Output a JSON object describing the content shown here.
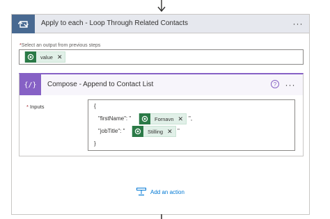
{
  "loop": {
    "title": "Apply to each - Loop Through Related Contacts",
    "more_label": "···",
    "select_label_required": "*",
    "select_label": "Select an output from previous steps",
    "token": {
      "label": "value",
      "icon": "dataverse-icon",
      "close": "✕"
    }
  },
  "compose": {
    "title": "Compose - Append to Contact List",
    "help_label": "?",
    "more_label": "···",
    "inputs_label_required": "*",
    "inputs_label": "Inputs",
    "json": {
      "open": "{",
      "line1_prefix": "\"firstName\": \"",
      "line1_token": "Fornavn",
      "line1_suffix": "\",",
      "line2_prefix": "\"jobTitle\": \"",
      "line2_token": "Stilling",
      "line2_suffix": "\"",
      "close": "}"
    },
    "token_close": "✕"
  },
  "add_action": {
    "label": "Add an action"
  },
  "colors": {
    "loop_accent": "#486991",
    "compose_accent": "#8661c5",
    "token_green": "#2b7a47",
    "link_blue": "#0078d4"
  }
}
